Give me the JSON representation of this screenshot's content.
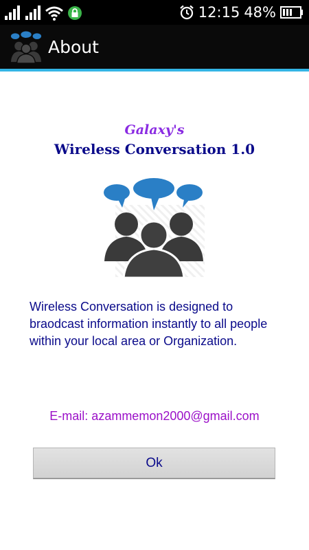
{
  "status_bar": {
    "time": "12:15",
    "battery_percent": "48%",
    "icons": [
      "signal-icon",
      "signal-icon",
      "wifi-icon",
      "lock-icon",
      "alarm-icon",
      "battery-icon"
    ]
  },
  "action_bar": {
    "title": "About",
    "icon": "people-chat-icon"
  },
  "about": {
    "brand": "Galaxy's",
    "app_title": "Wireless Conversation 1.0",
    "logo_icon": "people-chat-icon",
    "description": "Wireless Conversation is designed to braodcast information instantly to all people within your local area or Organization.",
    "email": "E-mail: azammemon2000@gmail.com",
    "ok_label": "Ok"
  },
  "colors": {
    "brand": "#8a2be2",
    "title": "#0a0a8a",
    "email": "#9b10c8",
    "accent": "#33b5e5",
    "bubble": "#2a7fc6",
    "figure": "#3a3a3a"
  }
}
